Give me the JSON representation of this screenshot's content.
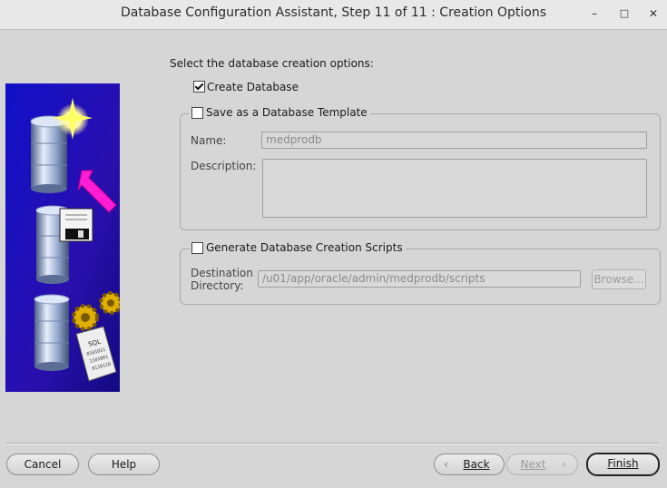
{
  "window": {
    "title": "Database Configuration Assistant, Step 11 of 11 : Creation Options",
    "minimize_glyph": "–",
    "maximize_glyph": "□",
    "close_glyph": "✕"
  },
  "main": {
    "prompt": "Select the database creation options:",
    "create_database": {
      "label": "Create Database",
      "checked": true
    },
    "save_template": {
      "label": "Save as a Database Template",
      "checked": false,
      "name_label": "Name:",
      "name_value": "medprodb",
      "description_label": "Description:",
      "description_value": ""
    },
    "generate_scripts": {
      "label": "Generate Database Creation Scripts",
      "checked": false,
      "destination_label_line1": "Destination",
      "destination_label_line2": "Directory:",
      "destination_value": "/u01/app/oracle/admin/medprodb/scripts",
      "browse_label": "Browse..."
    }
  },
  "footer": {
    "cancel_label": "Cancel",
    "help_label": "Help",
    "back_label": "Back",
    "next_label": "Next",
    "finish_label": "Finish"
  },
  "colors": {
    "background": "#d6d6d6",
    "titlebar": "#e8e8e8",
    "side_panel_blue": "#1a1aa8",
    "accent_magenta": "#ff1cd2"
  },
  "icons": {
    "side_image": "database-creation-illustration",
    "back": "chevron-left-icon",
    "next": "chevron-right-icon"
  }
}
